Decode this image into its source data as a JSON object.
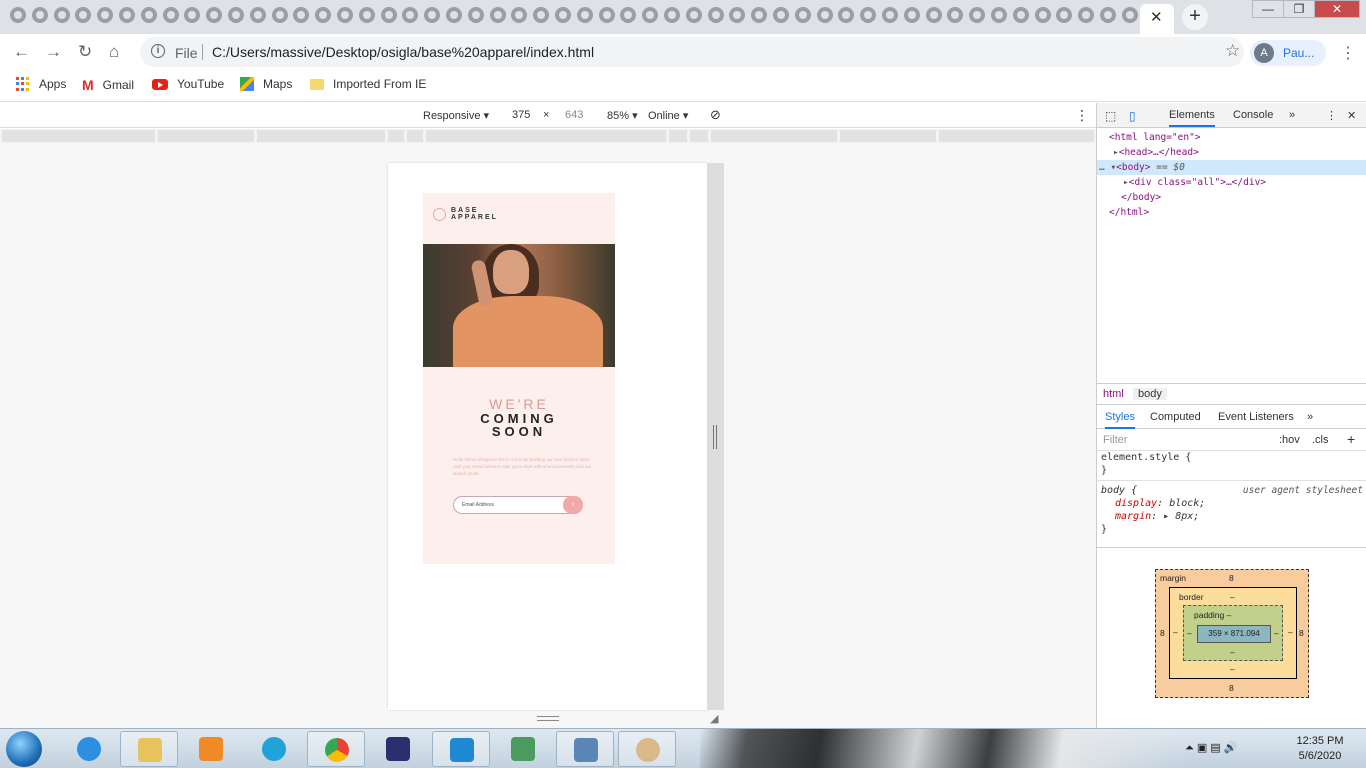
{
  "tabs": {
    "active_close": "✕",
    "new_tab": "+",
    "window_controls": [
      "—",
      "❐",
      "✕"
    ],
    "favicon_count": 53
  },
  "toolbar": {
    "back": "←",
    "forward": "→",
    "reload": "↻",
    "home": "⌂",
    "info": "i",
    "scheme": "File",
    "url": "C:/Users/massive/Desktop/osigla/base%20apparel/index.html",
    "star": "☆",
    "profile_initial": "A",
    "profile_name": "Pau...",
    "menu": "⋮"
  },
  "bookmarks": [
    {
      "label": "Apps",
      "icon": "apps-grid-icon"
    },
    {
      "label": "Gmail",
      "icon": "gmail-icon"
    },
    {
      "label": "YouTube",
      "icon": "youtube-icon"
    },
    {
      "label": "Maps",
      "icon": "maps-icon"
    },
    {
      "label": "Imported From IE",
      "icon": "folder-icon"
    }
  ],
  "device_toolbar": {
    "mode": "Responsive ▾",
    "width": "375",
    "times": "×",
    "height": "643",
    "zoom": "85% ▾",
    "network": "Online ▾",
    "rotate_icon": "⊘",
    "menu": "⋮"
  },
  "site": {
    "logo_line1": "BASE",
    "logo_line2": "APPAREL",
    "heading_light": "WE'RE",
    "heading_bold1": "COMING",
    "heading_bold2": "SOON",
    "blurb": "Hello fellow shoppers! We're currently building our new fashion store. Add your email below to stay up-to-date with announcements and our launch deals.",
    "email_placeholder": "Email Address",
    "submit_icon": "›",
    "accent": "#f2a8a8",
    "background": "#fdf0ec"
  },
  "devtools": {
    "tabs": [
      "Elements",
      "Console",
      "»"
    ],
    "dom": {
      "html_open": "<html lang=\"en\">",
      "head": "<head>…</head>",
      "body_open": "<body>",
      "body_eq": "== $0",
      "div": "<div class=\"all\">…</div>",
      "body_close": "</body>",
      "html_close": "</html>"
    },
    "breadcrumbs": [
      "html",
      "body"
    ],
    "style_tabs": [
      "Styles",
      "Computed",
      "Event Listeners",
      "»"
    ],
    "filter_placeholder": "Filter",
    "hov": ":hov",
    "cls": ".cls",
    "add": "+",
    "element_style": "element.style {",
    "close_brace": "}",
    "body_selector": "body {",
    "ua_label": "user agent stylesheet",
    "decl1_prop": "display",
    "decl1_val": "block;",
    "decl2_prop": "margin",
    "decl2_val": "▸ 8px;",
    "box": {
      "margin_label": "margin",
      "margin_top": "8",
      "margin_bottom": "8",
      "margin_left": "8",
      "margin_right": "8",
      "border_label": "border",
      "border_val": "–",
      "padding_label": "padding –",
      "padding_val": "–",
      "content": "359 × 871.094"
    }
  },
  "taskbar": {
    "time": "12:35 PM",
    "date": "5/6/2020",
    "tray": "⏶  ▣  ▤  🔊"
  }
}
